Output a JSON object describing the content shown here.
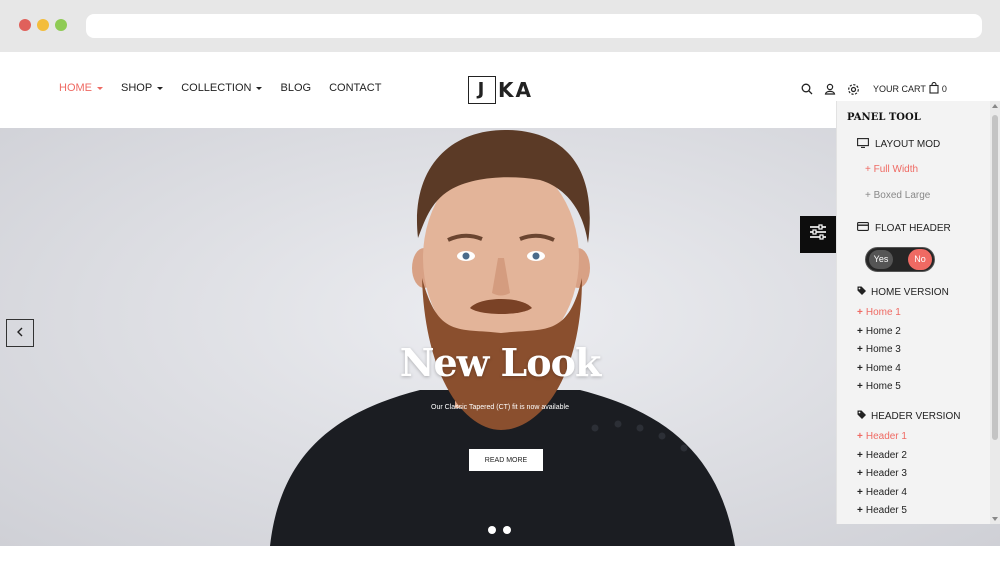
{
  "nav": {
    "items": [
      {
        "label": "HOME",
        "has_caret": true,
        "active": true
      },
      {
        "label": "SHOP",
        "has_caret": true,
        "active": false
      },
      {
        "label": "COLLECTION",
        "has_caret": true,
        "active": false
      },
      {
        "label": "BLOG",
        "has_caret": false,
        "active": false
      },
      {
        "label": "CONTACT",
        "has_caret": false,
        "active": false
      }
    ]
  },
  "logo": {
    "boxed_letter": "J",
    "rest": "KA"
  },
  "header_tools": {
    "cart_label": "YOUR CART",
    "cart_count": "0",
    "icons": [
      "search-icon",
      "user-icon",
      "gear-icon",
      "bag-icon"
    ]
  },
  "hero": {
    "title": "New Look",
    "subtitle": "Our Classic Tapered (CT) fit is now available",
    "button_label": "READ MORE",
    "slides": 2,
    "active_slide": 1
  },
  "panel": {
    "title": "PANEL TOOL",
    "layout_heading": "LAYOUT MOD",
    "layout_options": [
      {
        "label": "+ Full Width",
        "active": true
      },
      {
        "label": "+ Boxed Large",
        "active": false
      }
    ],
    "float_heading": "FLOAT HEADER",
    "toggle_yes": "Yes",
    "toggle_no": "No",
    "home_heading": "HOME VERSION",
    "home_items": [
      {
        "label": "Home 1",
        "active": true
      },
      {
        "label": "Home 2",
        "active": false
      },
      {
        "label": "Home 3",
        "active": false
      },
      {
        "label": "Home 4",
        "active": false
      },
      {
        "label": "Home 5",
        "active": false
      }
    ],
    "header_heading": "HEADER VERSION",
    "header_items": [
      {
        "label": "Header 1",
        "active": true
      },
      {
        "label": "Header 2",
        "active": false
      },
      {
        "label": "Header 3",
        "active": false
      },
      {
        "label": "Header 4",
        "active": false
      },
      {
        "label": "Header 5",
        "active": false
      }
    ]
  },
  "colors": {
    "accent": "#ef6a63",
    "dark": "#0d0d0d",
    "panel_bg": "#f3f3f3"
  }
}
